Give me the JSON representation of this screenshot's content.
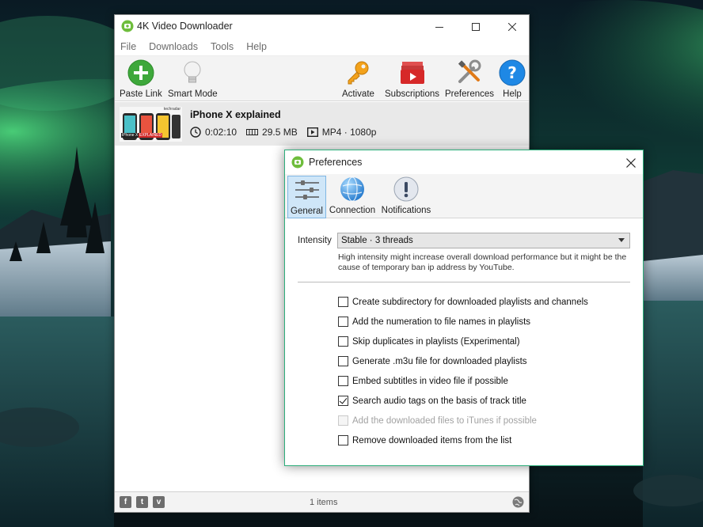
{
  "main_window": {
    "title": "4K Video Downloader",
    "menu": [
      "File",
      "Downloads",
      "Tools",
      "Help"
    ],
    "toolbar": {
      "paste_link": "Paste Link",
      "smart_mode": "Smart Mode",
      "activate": "Activate",
      "subscriptions": "Subscriptions",
      "preferences": "Preferences",
      "help": "Help"
    },
    "download_item": {
      "title": "iPhone X explained",
      "duration": "0:02:10",
      "size": "29.5 MB",
      "format": "MP4 · 1080p",
      "thumb_brand": "techradar",
      "thumb_caption_a": "iPhone X",
      "thumb_caption_b": "EXPLAINED"
    },
    "status": {
      "items_count": "1 items",
      "social": [
        "f",
        "t",
        "v"
      ]
    }
  },
  "preferences": {
    "title": "Preferences",
    "tabs": [
      {
        "label": "General",
        "active": true
      },
      {
        "label": "Connection",
        "active": false
      },
      {
        "label": "Notifications",
        "active": false
      }
    ],
    "intensity_label": "Intensity",
    "intensity_value": "Stable · 3 threads",
    "intensity_hint": "High intensity might increase overall download performance but it might be the cause of temporary ban ip address by YouTube.",
    "options": [
      {
        "label": "Create subdirectory for downloaded playlists and channels",
        "checked": false,
        "disabled": false
      },
      {
        "label": "Add the numeration to file names in playlists",
        "checked": false,
        "disabled": false
      },
      {
        "label": "Skip duplicates in playlists (Experimental)",
        "checked": false,
        "disabled": false
      },
      {
        "label": "Generate .m3u file for downloaded playlists",
        "checked": false,
        "disabled": false
      },
      {
        "label": "Embed subtitles in video file if possible",
        "checked": false,
        "disabled": false
      },
      {
        "label": "Search audio tags on the basis of track title",
        "checked": true,
        "disabled": false
      },
      {
        "label": "Add the downloaded files to iTunes if possible",
        "checked": false,
        "disabled": true
      },
      {
        "label": "Remove downloaded items from the list",
        "checked": false,
        "disabled": false
      }
    ]
  },
  "colors": {
    "accent_green": "#2dae7b",
    "paste_green": "#3ea83b",
    "help_blue": "#1e88e5",
    "tab_active_bg": "#cfe6f8"
  }
}
